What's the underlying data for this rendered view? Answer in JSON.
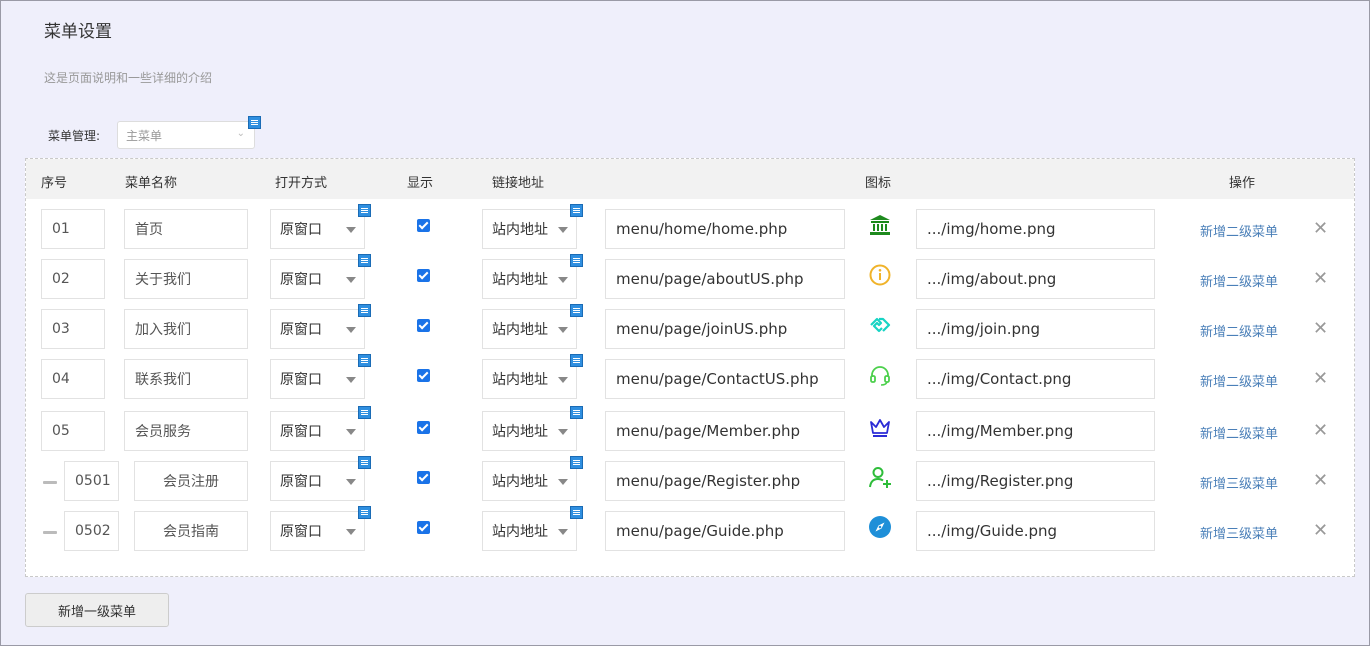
{
  "page": {
    "title": "菜单设置",
    "description": "这是页面说明和一些详细的介绍"
  },
  "menu_manager": {
    "label": "菜单管理:",
    "placeholder": "主菜单"
  },
  "table": {
    "headers": {
      "index": "序号",
      "name": "菜单名称",
      "open_mode": "打开方式",
      "show": "显示",
      "link": "链接地址",
      "icon": "图标",
      "action": "操作"
    },
    "rows": [
      {
        "index": "01",
        "name": "首页",
        "open_mode": "原窗口",
        "show": true,
        "link_type": "站内地址",
        "url": "menu/home/home.php",
        "icon": "bank-icon",
        "icon_color": "#1e8a1e",
        "icon_path": ".../img/home.png",
        "action": "新增二级菜单",
        "level": 1
      },
      {
        "index": "02",
        "name": "关于我们",
        "open_mode": "原窗口",
        "show": true,
        "link_type": "站内地址",
        "url": "menu/page/aboutUS.php",
        "icon": "info-circle-icon",
        "icon_color": "#f0b32a",
        "icon_path": ".../img/about.png",
        "action": "新增二级菜单",
        "level": 1
      },
      {
        "index": "03",
        "name": "加入我们",
        "open_mode": "原窗口",
        "show": true,
        "link_type": "站内地址",
        "url": "menu/page/joinUS.php",
        "icon": "handshake-icon",
        "icon_color": "#17d4c4",
        "icon_path": ".../img/join.png",
        "action": "新增二级菜单",
        "level": 1
      },
      {
        "index": "04",
        "name": "联系我们",
        "open_mode": "原窗口",
        "show": true,
        "link_type": "站内地址",
        "url": "menu/page/ContactUS.php",
        "icon": "headset-icon",
        "icon_color": "#4cd04c",
        "icon_path": ".../img/Contact.png",
        "action": "新增二级菜单",
        "level": 1
      },
      {
        "index": "05",
        "name": "会员服务",
        "open_mode": "原窗口",
        "show": true,
        "link_type": "站内地址",
        "url": "menu/page/Member.php",
        "icon": "crown-icon",
        "icon_color": "#2b2bd6",
        "icon_path": ".../img/Member.png",
        "action": "新增二级菜单",
        "level": 1
      },
      {
        "index": "0501",
        "name": "会员注册",
        "open_mode": "原窗口",
        "show": true,
        "link_type": "站内地址",
        "url": "menu/page/Register.php",
        "icon": "user-add-icon",
        "icon_color": "#2ebd3a",
        "icon_path": ".../img/Register.png",
        "action": "新增三级菜单",
        "level": 2
      },
      {
        "index": "0502",
        "name": "会员指南",
        "open_mode": "原窗口",
        "show": true,
        "link_type": "站内地址",
        "url": "menu/page/Guide.php",
        "icon": "compass-icon",
        "icon_color": "#1e8fd8",
        "icon_path": ".../img/Guide.png",
        "action": "新增三级菜单",
        "level": 2
      }
    ]
  },
  "footer": {
    "add_button": "新增一级菜单"
  }
}
